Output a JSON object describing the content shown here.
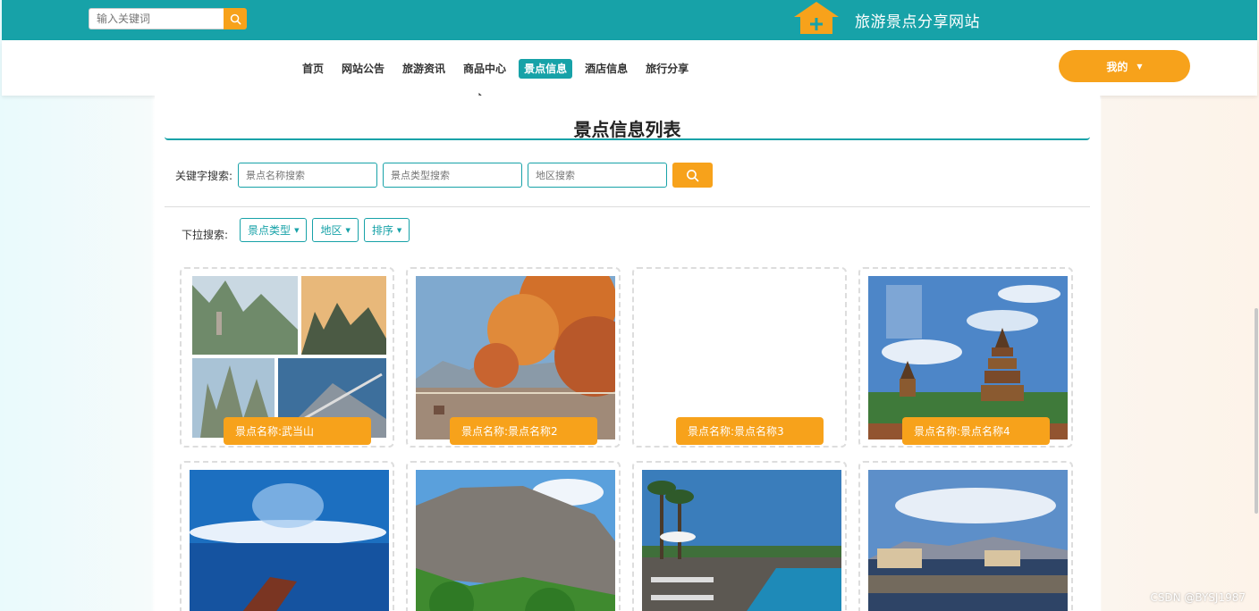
{
  "header": {
    "search_placeholder": "输入关键词",
    "site_title": "旅游景点分享网站"
  },
  "nav": {
    "items": [
      {
        "label": "首页",
        "active": false
      },
      {
        "label": "网站公告",
        "active": false
      },
      {
        "label": "旅游资讯",
        "active": false
      },
      {
        "label": "商品中心",
        "active": false
      },
      {
        "label": "景点信息",
        "active": true
      },
      {
        "label": "酒店信息",
        "active": false
      },
      {
        "label": "旅行分享",
        "active": false
      }
    ],
    "mine_label": "我的"
  },
  "main": {
    "title": "景点信息列表",
    "keyword_label": "关键字搜索:",
    "inputs": {
      "name_placeholder": "景点名称搜索",
      "type_placeholder": "景点类型搜索",
      "area_placeholder": "地区搜索"
    },
    "dropdown_label": "下拉搜索:",
    "dropdowns": [
      "景点类型",
      "地区",
      "排序"
    ],
    "cards": [
      {
        "label_prefix": "景点名称:",
        "name": "武当山",
        "image": "mountain-collage"
      },
      {
        "label_prefix": "景点名称:",
        "name": "景点名称2",
        "image": "autumn-lake"
      },
      {
        "label_prefix": "景点名称:",
        "name": "景点名称3",
        "image": "none"
      },
      {
        "label_prefix": "景点名称:",
        "name": "景点名称4",
        "image": "pagoda"
      },
      {
        "label_prefix": "",
        "name": "",
        "image": "sea-boat"
      },
      {
        "label_prefix": "",
        "name": "",
        "image": "cliff-forest"
      },
      {
        "label_prefix": "",
        "name": "",
        "image": "resort-pool"
      },
      {
        "label_prefix": "",
        "name": "",
        "image": "lake-town"
      }
    ]
  },
  "watermark": "CSDN @BYSJ1987",
  "colors": {
    "primary": "#17a2a8",
    "accent": "#f7a21b"
  }
}
